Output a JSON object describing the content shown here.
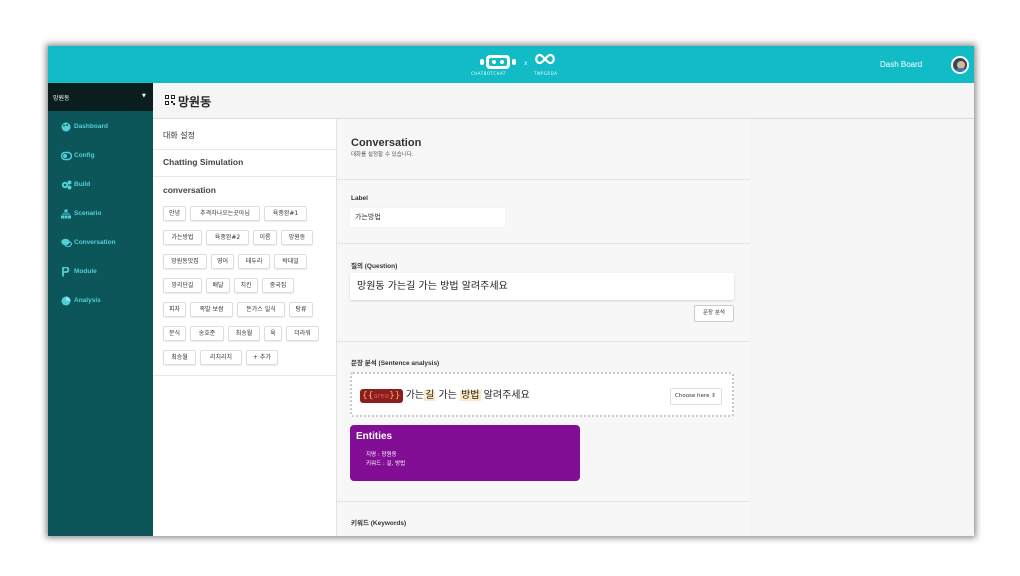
{
  "topbar": {
    "logo_left_text": "CHATBOTCHAT",
    "logo_x": "x",
    "logo_right_text": "TMPGRDA",
    "dashboard_link": "Dash Board",
    "brand_color": "#12bcc7"
  },
  "sidebar": {
    "workspace": "망원동",
    "items": [
      {
        "label": "Dashboard",
        "icon": "palette-icon"
      },
      {
        "label": "Config",
        "icon": "toggle-icon"
      },
      {
        "label": "Build",
        "icon": "gears-icon"
      },
      {
        "label": "Scenario",
        "icon": "sitemap-icon"
      },
      {
        "label": "Conversation",
        "icon": "chat-icon"
      },
      {
        "label": "Module",
        "icon": "parking-icon"
      },
      {
        "label": "Analysis",
        "icon": "pie-chart-icon"
      }
    ]
  },
  "page": {
    "title": "망원동"
  },
  "left_panel": {
    "item1": "대화 설정",
    "item2": "Chatting Simulation",
    "item3": "conversation",
    "chips": [
      "안녕",
      "추격자나오는곳아님",
      "육중완#1",
      "가는방법",
      "육중완#2",
      "이름",
      "망원동",
      "망원동맛집",
      "영어",
      "태두리",
      "박대일",
      "망리단길",
      "배달",
      "치킨",
      "중국집",
      "피자",
      "족발 보쌈",
      "돈가스 일식",
      "탕류",
      "분식",
      "송호준",
      "최송월",
      "육",
      "더라워",
      "최승월",
      "리치리치",
      "+ 추가"
    ]
  },
  "conversation": {
    "title": "Conversation",
    "subtitle": "대화를 설정할 수 있습니다.",
    "label_title": "Label",
    "label_value": "가는방법",
    "question_title": "질의 (Question)",
    "question_value": "망원동 가는길 가는 방법 알려주세요",
    "analyze_button": "문장 분석",
    "sentence_title": "문장 분석 (Sentence analysis)",
    "sentence": {
      "entity_open": "{{",
      "entity_name": "area",
      "entity_close": "}}",
      "part1": " 가는",
      "kw1": "길",
      "part2": " 가는 ",
      "kw2": "방법",
      "part3": " 알려주세요"
    },
    "choose_label": "Choose here",
    "choose_caret": "⇕",
    "entities_title": "Entities",
    "entity_line1": "지명 : 망원동",
    "entity_line2": "키워드 : 길, 방법",
    "keywords_title": "키워드 (Keywords)",
    "entities_color": "#830e96"
  }
}
